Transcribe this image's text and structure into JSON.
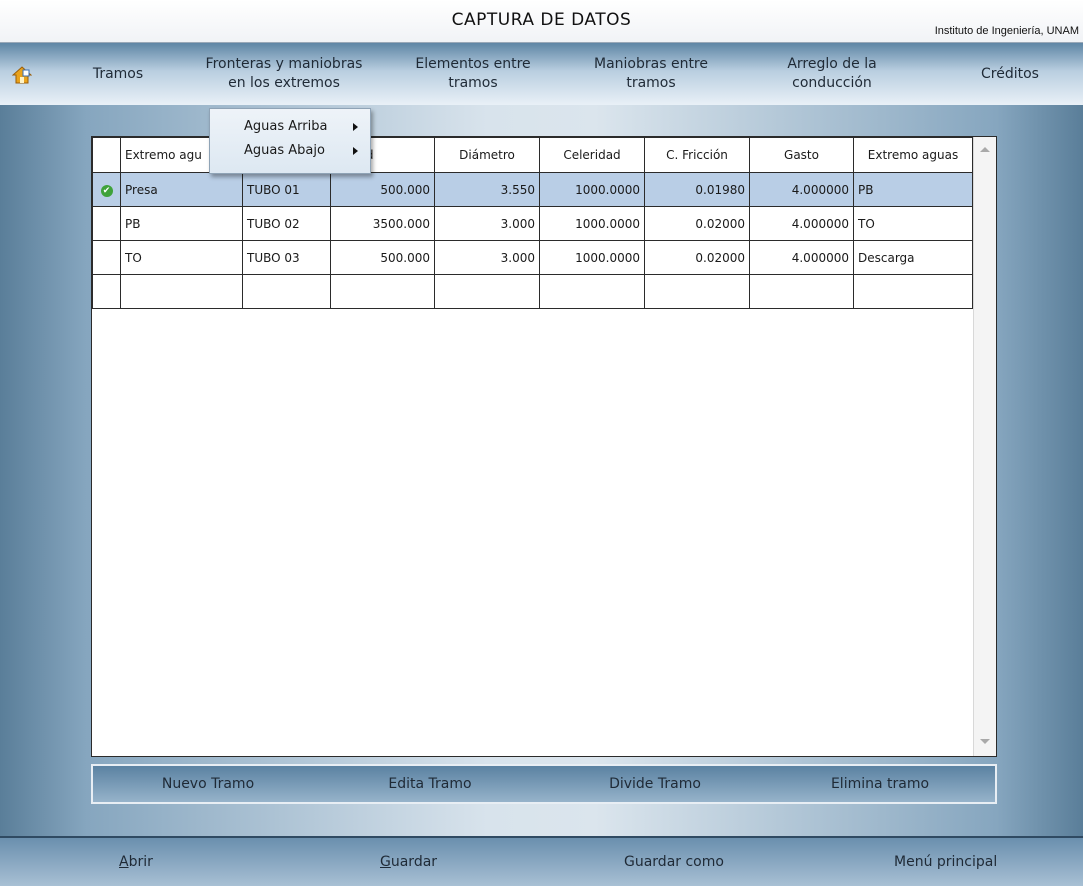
{
  "window": {
    "title": "CAPTURA DE DATOS",
    "institution": "Instituto de Ingeniería, UNAM"
  },
  "menu": {
    "home_icon": "home-icon",
    "items": [
      {
        "label": "Tramos"
      },
      {
        "label": "Fronteras y maniobras\nen los extremos"
      },
      {
        "label": "Elementos entre\ntramos"
      },
      {
        "label": "Maniobras entre\ntramos"
      },
      {
        "label": "Arreglo de la\nconducción"
      },
      {
        "label": "Créditos"
      }
    ]
  },
  "dropdown": {
    "items": [
      {
        "label": "Aguas Arriba"
      },
      {
        "label": "Aguas Abajo"
      }
    ]
  },
  "grid": {
    "columns": [
      "Extremo agu",
      "",
      "ngitud",
      "Diámetro",
      "Celeridad",
      "C. Fricción",
      "Gasto",
      "Extremo aguas"
    ],
    "rows": [
      {
        "selected": true,
        "cells": [
          "Presa",
          "TUBO 01",
          "500.000",
          "3.550",
          "1000.0000",
          "0.01980",
          "4.000000",
          "PB"
        ]
      },
      {
        "selected": false,
        "cells": [
          "PB",
          "TUBO 02",
          "3500.000",
          "3.000",
          "1000.0000",
          "0.02000",
          "4.000000",
          "TO"
        ]
      },
      {
        "selected": false,
        "cells": [
          "TO",
          "TUBO 03",
          "500.000",
          "3.000",
          "1000.0000",
          "0.02000",
          "4.000000",
          "Descarga"
        ]
      },
      {
        "selected": false,
        "cells": [
          "",
          "",
          "",
          "",
          "",
          "",
          "",
          ""
        ]
      }
    ]
  },
  "actions": {
    "new": "Nuevo Tramo",
    "edit": "Edita Tramo",
    "divide": "Divide Tramo",
    "delete": "Elimina tramo"
  },
  "bottom": {
    "open_accel": "A",
    "open_rest": "brir",
    "save_accel": "G",
    "save_rest": "uardar",
    "save_as": "Guardar como",
    "main_menu": "Menú principal"
  }
}
